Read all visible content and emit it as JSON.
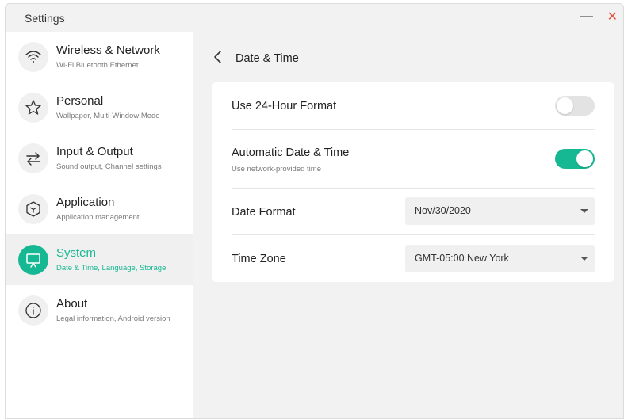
{
  "window": {
    "title": "Settings",
    "minimize_icon": "minimize-icon",
    "close_icon": "close-icon"
  },
  "colors": {
    "accent": "#16b893",
    "close": "#e0533d",
    "toggle_off": "#e3e3e3"
  },
  "sidebar": {
    "items": [
      {
        "label": "Wireless & Network",
        "sub": "Wi-Fi Bluetooth Ethernet",
        "icon": "wifi-icon",
        "active": false
      },
      {
        "label": "Personal",
        "sub": "Wallpaper, Multi-Window Mode",
        "icon": "star-icon",
        "active": false
      },
      {
        "label": "Input & Output",
        "sub": "Sound output, Channel settings",
        "icon": "arrows-swap-icon",
        "active": false
      },
      {
        "label": "Application",
        "sub": "Application management",
        "icon": "cube-icon",
        "active": false
      },
      {
        "label": "System",
        "sub": "Date & Time, Language, Storage",
        "icon": "monitor-icon",
        "active": true
      },
      {
        "label": "About",
        "sub": "Legal information, Android version",
        "icon": "info-icon",
        "active": false
      }
    ]
  },
  "page": {
    "title": "Date & Time",
    "back_icon": "chevron-left-icon"
  },
  "settings": {
    "use24": {
      "label": "Use 24-Hour Format",
      "enabled": false
    },
    "auto": {
      "label": "Automatic Date & Time",
      "sub": "Use network-provided time",
      "enabled": true
    },
    "date_format": {
      "label": "Date Format",
      "value": "Nov/30/2020"
    },
    "time_zone": {
      "label": "Time Zone",
      "value": "GMT-05:00 New York"
    }
  }
}
